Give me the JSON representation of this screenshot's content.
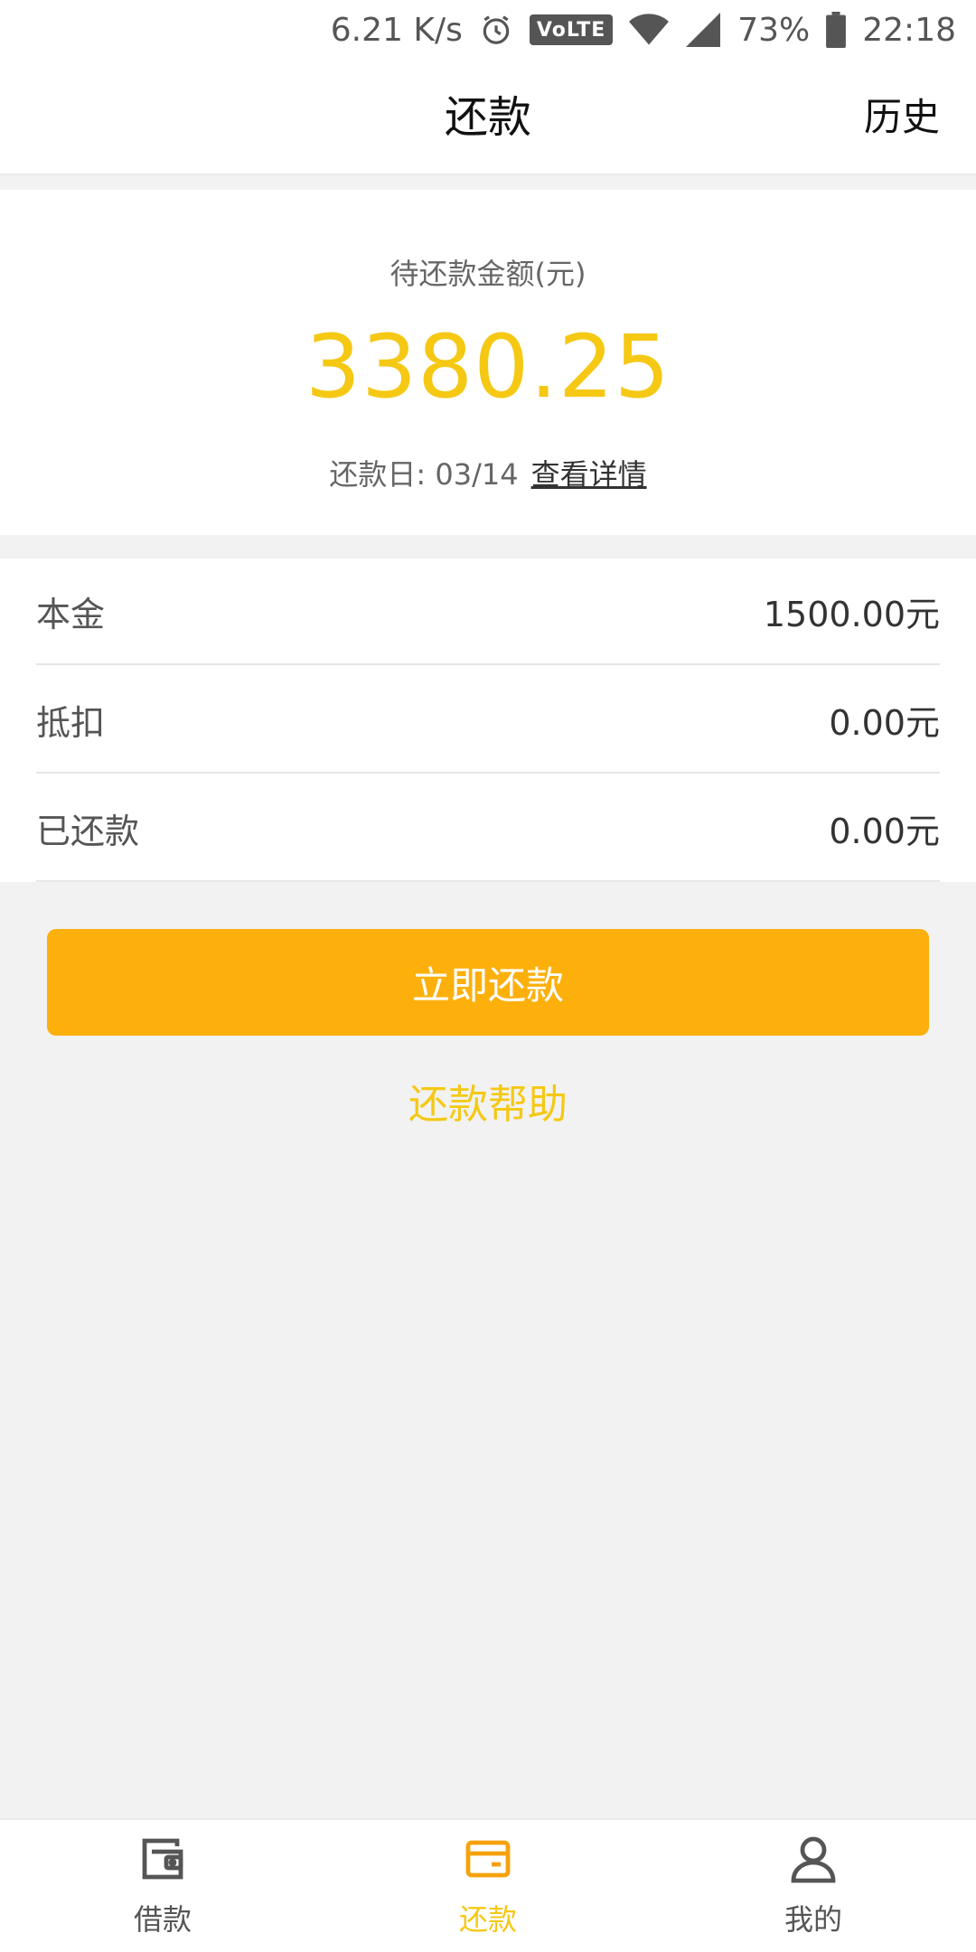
{
  "status_bar": {
    "network_speed": "6.21 K/s",
    "volte": "VoLTE",
    "battery": "73%",
    "time": "22:18"
  },
  "header": {
    "title": "还款",
    "history_label": "历史"
  },
  "summary": {
    "amount_label": "待还款金额(元)",
    "amount": "3380.25",
    "due_label": "还款日: 03/14",
    "detail_link": "查看详情"
  },
  "breakdown": [
    {
      "label": "本金",
      "value": "1500.00元"
    },
    {
      "label": "抵扣",
      "value": "0.00元"
    },
    {
      "label": "已还款",
      "value": "0.00元"
    }
  ],
  "actions": {
    "pay_now": "立即还款",
    "help": "还款帮助"
  },
  "bottom_nav": [
    {
      "label": "借款",
      "icon": "wallet-icon",
      "active": false
    },
    {
      "label": "还款",
      "icon": "card-icon",
      "active": true
    },
    {
      "label": "我的",
      "icon": "user-icon",
      "active": false
    }
  ],
  "colors": {
    "accent": "#f5c814",
    "button": "#fdb00c",
    "background": "#f2f2f2",
    "inactive": "#555555"
  }
}
